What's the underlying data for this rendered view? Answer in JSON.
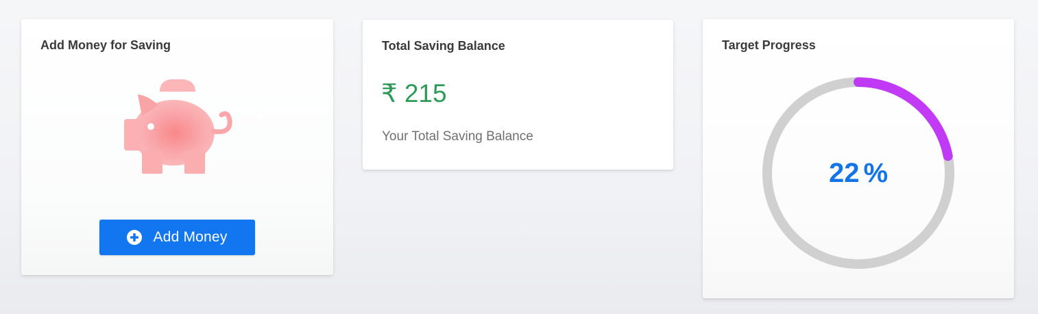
{
  "add_card": {
    "title": "Add Money for Saving",
    "icon": "piggy-bank-icon",
    "button_label": "Add Money",
    "button_icon": "plus-circle-icon"
  },
  "balance_card": {
    "title": "Total Saving Balance",
    "amount": "₹ 215",
    "description": "Your Total Saving Balance"
  },
  "target_card": {
    "title": "Target Progress",
    "progress_value": "22",
    "progress_unit": "%",
    "progress_fraction": 0.22
  },
  "colors": {
    "button": "#1176f0",
    "balance_amount": "#2e9a58",
    "progress_text": "#1473e6",
    "ring_track": "#cfd0cf",
    "ring_progress_start": "#9a39f3",
    "ring_progress_end": "#c93af5",
    "piggy": "#f7a3a6"
  }
}
